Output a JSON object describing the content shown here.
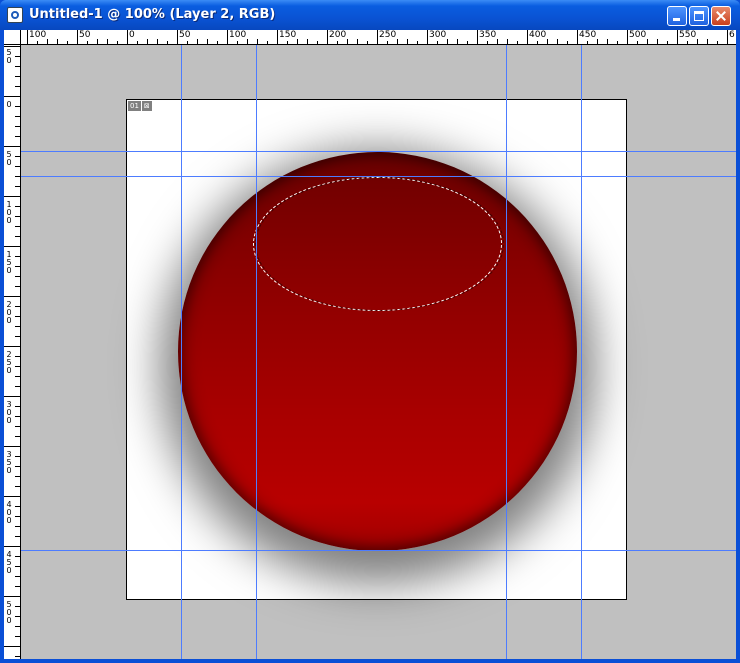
{
  "window": {
    "title": "Untitled-1 @ 100% (Layer 2, RGB)",
    "icon": "photoshop-document-icon",
    "buttons": {
      "minimize": "minimize-icon",
      "maximize": "maximize-icon",
      "close": "close-icon"
    }
  },
  "rulers": {
    "horizontal_labels": [
      "100",
      "50",
      "0",
      "50",
      "100",
      "150",
      "200",
      "250",
      "300",
      "350",
      "400",
      "450",
      "500",
      "550",
      "6"
    ],
    "vertical_labels": [
      "5\n0",
      "0",
      "5\n0",
      "1\n0\n0",
      "1\n5\n0",
      "2\n0\n0",
      "2\n5\n0",
      "3\n0\n0",
      "3\n5\n0",
      "4\n0\n0",
      "4\n5\n0",
      "5\n0\n0"
    ]
  },
  "document": {
    "layer_badge": [
      "01",
      "⊠"
    ],
    "ball_color": "#b80000",
    "background_color": "#ffffff",
    "guide_color": "#4d7cff",
    "workspace_color": "#c0c0c0"
  }
}
